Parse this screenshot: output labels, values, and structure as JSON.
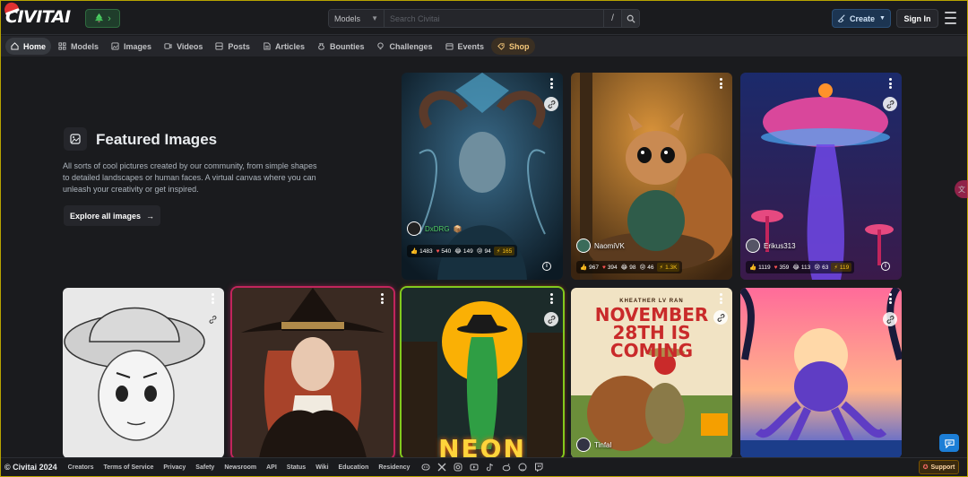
{
  "header": {
    "logo_text": "CIVITAI",
    "search_category": "Models",
    "search_placeholder": "Search Civitai",
    "search_shortcut": "/",
    "create_label": "Create",
    "signin_label": "Sign In"
  },
  "nav": {
    "items": [
      {
        "label": "Home",
        "icon": "home-icon"
      },
      {
        "label": "Models",
        "icon": "grid-icon"
      },
      {
        "label": "Images",
        "icon": "image-icon"
      },
      {
        "label": "Videos",
        "icon": "video-icon"
      },
      {
        "label": "Posts",
        "icon": "posts-icon"
      },
      {
        "label": "Articles",
        "icon": "article-icon"
      },
      {
        "label": "Bounties",
        "icon": "moneybag-icon"
      },
      {
        "label": "Challenges",
        "icon": "bulb-icon"
      },
      {
        "label": "Events",
        "icon": "calendar-icon"
      },
      {
        "label": "Shop",
        "icon": "shop-icon"
      }
    ]
  },
  "featured": {
    "title": "Featured Images",
    "description": "All sorts of cool pictures created by our community, from simple shapes to detailed landscapes or human faces. A virtual canvas where you can unleash your creativity or get inspired.",
    "explore_label": "Explore all images"
  },
  "cards": [
    {
      "username": "DxDRG",
      "likes": "1483",
      "hearts": "540",
      "laughs": "149",
      "cries": "94",
      "buzz": "165"
    },
    {
      "username": "NaomiVK",
      "likes": "967",
      "hearts": "394",
      "laughs": "98",
      "cries": "46",
      "buzz": "1.3K"
    },
    {
      "username": "Erikus313",
      "likes": "1119",
      "hearts": "359",
      "laughs": "113",
      "cries": "63",
      "buzz": "119"
    },
    {
      "username": ""
    },
    {
      "username": ""
    },
    {
      "username": "",
      "text": "NEON"
    },
    {
      "username": "Tinfal",
      "text_small": "KHEATHER LV RAN",
      "text_big": "NOVEMBER 28TH IS COMING"
    },
    {
      "username": ""
    }
  ],
  "footer": {
    "copyright": "© Civitai 2024",
    "links": [
      "Creators",
      "Terms of Service",
      "Privacy",
      "Safety",
      "Newsroom",
      "API",
      "Status",
      "Wiki",
      "Education",
      "Residency"
    ],
    "support_label": "Support"
  },
  "colors": {
    "background": "#1a1b1e",
    "nav_background": "#25262b",
    "accent_blue": "#1c7ed6",
    "buzz_yellow": "#fcc419"
  }
}
